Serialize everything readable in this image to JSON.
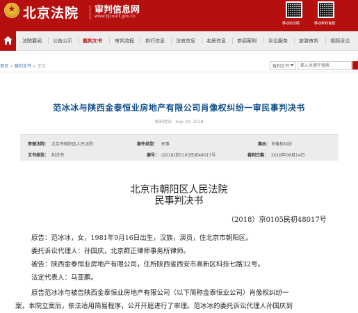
{
  "header": {
    "brand": "北京法院",
    "site_name": "审判信息网",
    "site_url": "www.bjcourt.gov.cn",
    "qr1_label": "移动尚法眼",
    "qr2_label": "移动审判官服"
  },
  "nav": {
    "items": [
      "法院要闻",
      "公告公示",
      "裁判文书",
      "审判流程",
      "执行信息",
      "法官信息",
      "名册信息",
      "参阅案例",
      "诉讼服务",
      "旅游审判",
      "视频诉讼"
    ],
    "active_index": 2
  },
  "breadcrumb": {
    "home": "首页",
    "section": "裁判文书",
    "current": "正文",
    "sep": " > "
  },
  "search": {
    "select_value": "裁判文书",
    "placeholder": "输入关键字搜索"
  },
  "case": {
    "title": "范冰冰与陕西金泰恒业房地产有限公司肖像权纠纷一审民事判决书",
    "publish_label": "发布时间：",
    "publish_date": "Sep 20, 2018"
  },
  "info": {
    "court_label": "审理法院：",
    "court_value": "北京市朝阳区人民法院",
    "case_type_label": "案件类型：",
    "case_type_value": "民事",
    "cause_label": "案由：",
    "cause_value": "肖像权纠纷",
    "doc_type_label": "文书类型：",
    "doc_type_value": "判决书",
    "case_no_label": "案号：",
    "case_no_value": "(2018)京0105民初48017号",
    "date_label": "裁判日期：",
    "date_value": "2018年06月14日"
  },
  "document": {
    "court": "北京市朝阳区人民法院",
    "doc_type": "民事判决书",
    "case_no": "（2018）京0105民初48017号",
    "paragraphs": [
      "原告：范冰冰，女，1981年9月16日出生，汉族，演员，住北京市朝阳区。",
      "委托诉讼代理人：孙国庆，北京群正律师事务所律师。",
      "被告：陕西金泰恒业房地产有限公司，住所陕西省西安市高新区科技七路32号。",
      "法定代表人：马亚鹏。",
      "原告范冰冰与被告陕西金泰恒业房地产有限公司（以下简称金泰恒业公司）肖像权纠纷一",
      "案，本院立案后，依法适用简易程序，公开开庭进行了审理。范冰冰的委托诉讼代理人孙国庆到"
    ]
  }
}
